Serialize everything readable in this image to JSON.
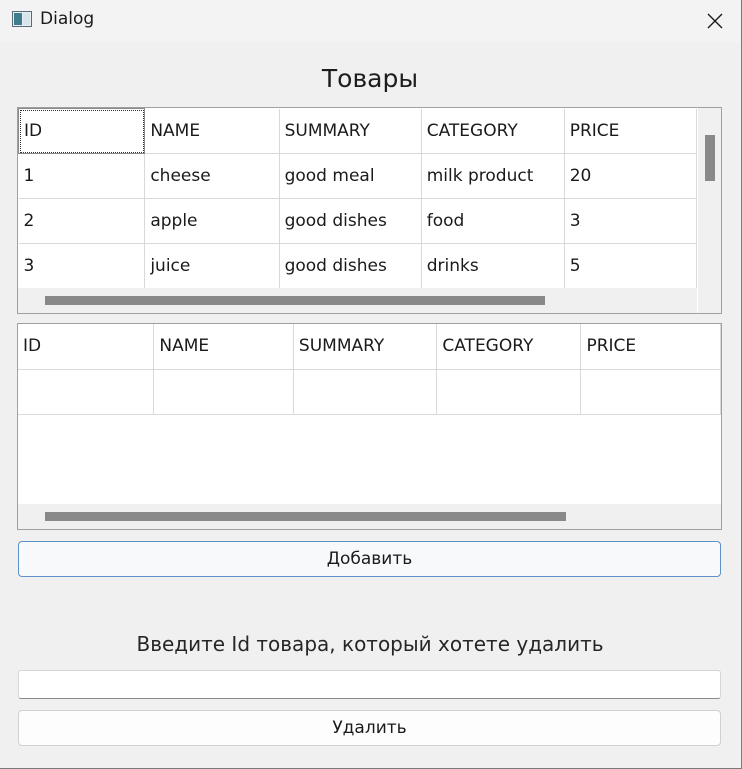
{
  "window": {
    "title": "Dialog"
  },
  "products_heading": "Товары",
  "products_table": {
    "columns": [
      "ID",
      "NAME",
      "SUMMARY",
      "CATEGORY",
      "PRICE"
    ],
    "rows": [
      [
        "1",
        "cheese",
        "good meal",
        "milk product",
        "20"
      ],
      [
        "2",
        "apple",
        "good dishes",
        "food",
        "3"
      ],
      [
        "3",
        "juice",
        "good dishes",
        "drinks",
        "5"
      ]
    ]
  },
  "second_table": {
    "columns": [
      "ID",
      "NAME",
      "SUMMARY",
      "CATEGORY",
      "PRICE"
    ],
    "rows": [
      [
        "",
        "",
        "",
        "",
        ""
      ]
    ]
  },
  "add_button_label": "Добавить",
  "delete_prompt": "Введите Id товара, который хотете удалить",
  "delete_input": {
    "value": "",
    "placeholder": ""
  },
  "delete_button_label": "Удалить",
  "icons": {
    "app": "window-app-icon",
    "close": "close-icon"
  }
}
